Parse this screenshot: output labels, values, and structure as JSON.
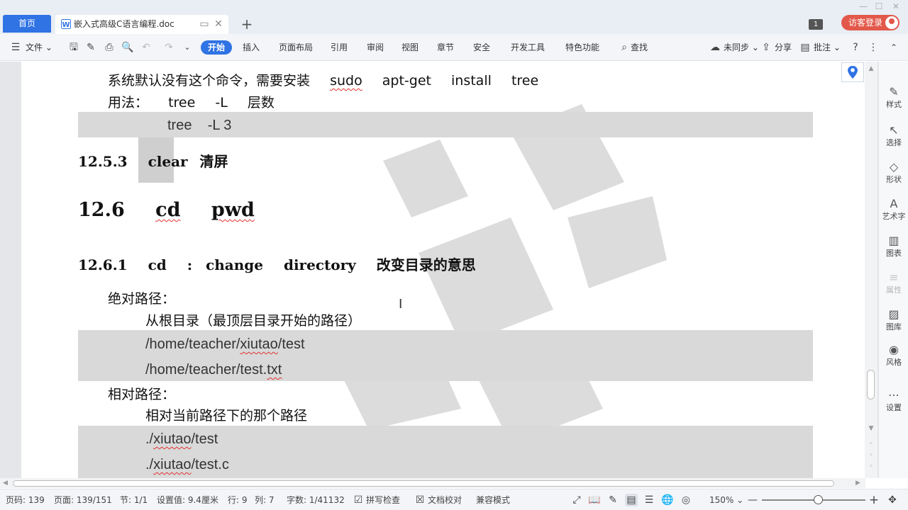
{
  "tabs": {
    "home": "首页",
    "document": "嵌入式高级C语言编程.doc",
    "badge": "1",
    "login": "访客登录"
  },
  "toolbar": {
    "file": "文件",
    "start": "开始",
    "insert": "插入",
    "page_layout": "页面布局",
    "references": "引用",
    "review": "审阅",
    "view": "视图",
    "chapter": "章节",
    "security": "安全",
    "dev_tools": "开发工具",
    "features": "特色功能",
    "search": "查找",
    "sync": "未同步",
    "share": "分享",
    "comment": "批注"
  },
  "document": {
    "line1_text": "系统默认没有这个命令，需要安装",
    "line1_cmd": [
      "sudo",
      "apt-get",
      "install",
      "tree"
    ],
    "line2_label": "用法：",
    "line2_cmd": [
      "tree",
      "-L",
      "层数"
    ],
    "code1": "tree    -L 3",
    "h_1253_num": "12.5.3",
    "h_1253_cmd": "clear",
    "h_1253_title": "清屏",
    "h_126_num": "12.6",
    "h_126_a": "cd",
    "h_126_b": "pwd",
    "h_1261_num": "12.6.1",
    "h_1261_cmd": "cd",
    "h_1261_sep": ":",
    "h_1261_en1": "change",
    "h_1261_en2": "directory",
    "h_1261_cn": "改变目录的意思",
    "abs_label": "绝对路径：",
    "abs_desc": "从根目录（最顶层目录开始的路径）",
    "abs_ex1_a": "/home/teacher/",
    "abs_ex1_b": "xiutao",
    "abs_ex1_c": "/test",
    "abs_ex2_a": "/home/teacher/test.",
    "abs_ex2_b": "txt",
    "rel_label": "相对路径：",
    "rel_desc": "相对当前路径下的那个路径",
    "rel_ex1_a": "./",
    "rel_ex1_b": "xiutao",
    "rel_ex1_c": "/test",
    "rel_ex2_a": "./",
    "rel_ex2_b": "xiutao",
    "rel_ex2_c": "/test.c"
  },
  "sidepanel": {
    "style": "样式",
    "select": "选择",
    "shape": "形状",
    "wordart": "艺术字",
    "chart": "图表",
    "properties": "属性",
    "gallery": "图库",
    "theme": "风格",
    "settings": "设置"
  },
  "statusbar": {
    "page_code": "页码: 139",
    "page": "页面: 139/151",
    "section": "节: 1/1",
    "setting": "设置值: 9.4厘米",
    "row": "行: 9",
    "col": "列: 7",
    "word_count": "字数: 1/41132",
    "spell_check": "拼写检查",
    "doc_proof": "文档校对",
    "compat": "兼容模式",
    "zoom": "150%"
  },
  "colors": {
    "accent": "#2f73e4",
    "login": "#e2584a",
    "code_shade": "#d9d9d9",
    "spell_underline": "#e03030"
  }
}
